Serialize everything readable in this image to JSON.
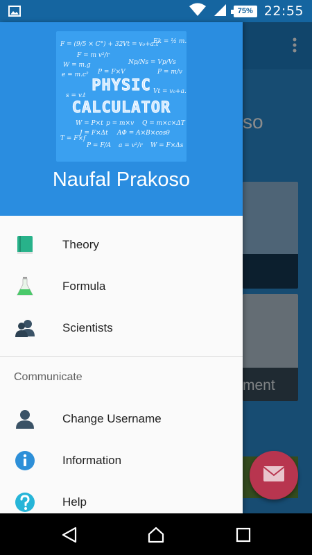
{
  "status_bar": {
    "time": "22:55",
    "battery": "75%",
    "icons": [
      "image-notification-icon",
      "wifi-icon",
      "cell-signal-icon",
      "battery-icon"
    ]
  },
  "background": {
    "title_fragment": "so",
    "card_label_fragment": "ment"
  },
  "drawer": {
    "header": {
      "logo_line1": "PHYSIC",
      "logo_line2": "CALCULATOR",
      "username": "Naufal Prakoso",
      "color": "#2a8de0"
    },
    "items": [
      {
        "label": "Theory",
        "icon": "book-icon"
      },
      {
        "label": "Formula",
        "icon": "flask-icon"
      },
      {
        "label": "Scientists",
        "icon": "people-icon"
      }
    ],
    "section_title": "Communicate",
    "communicate_items": [
      {
        "label": "Change Username",
        "icon": "person-icon"
      },
      {
        "label": "Information",
        "icon": "info-icon"
      },
      {
        "label": "Help",
        "icon": "help-icon"
      }
    ]
  },
  "fab": {
    "icon": "mail-icon",
    "color": "#b8354f"
  },
  "nav_bar": {
    "buttons": [
      "back-icon",
      "home-icon",
      "recents-icon"
    ]
  }
}
